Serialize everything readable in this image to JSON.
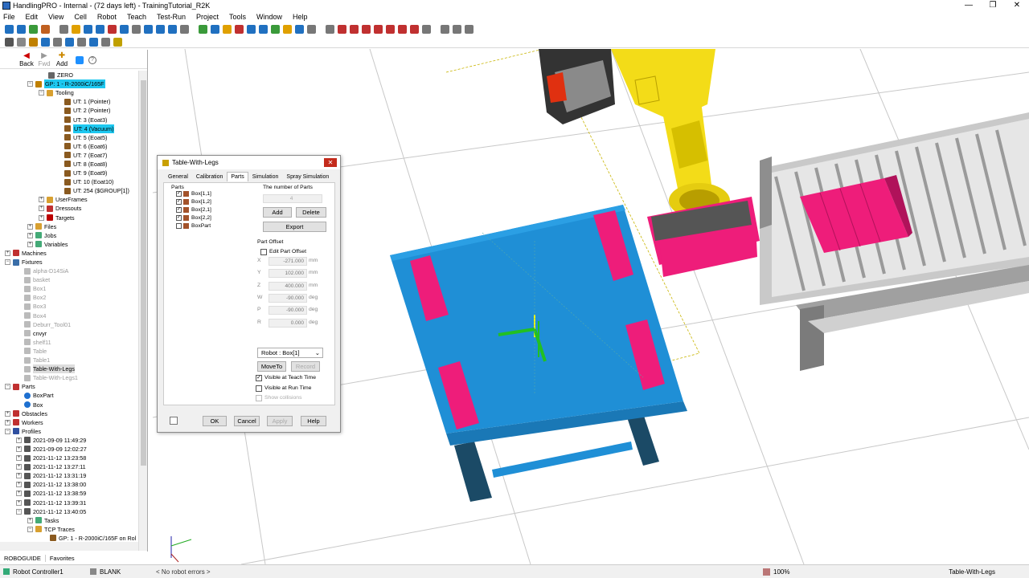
{
  "window": {
    "title": "HandlingPRO - Internal - (72 days left) - TrainingTutorial_R2K",
    "minimize": "—",
    "restore": "❐",
    "close": "✕"
  },
  "menu": [
    "File",
    "Edit",
    "View",
    "Cell",
    "Robot",
    "Teach",
    "Test-Run",
    "Project",
    "Tools",
    "Window",
    "Help"
  ],
  "nav": {
    "back": "Back",
    "fwd": "Fwd",
    "add": "Add"
  },
  "tree": [
    {
      "indent": 60,
      "label": "ZERO",
      "icon": "frame",
      "ex": ""
    },
    {
      "indent": 34,
      "label": "GP: 1 - R-2000iC/165F",
      "icon": "robot",
      "ex": "−",
      "sel": true
    },
    {
      "indent": 48,
      "label": "Tooling",
      "icon": "folder",
      "ex": "−"
    },
    {
      "indent": 80,
      "label": "UT: 1  (Pointer)",
      "icon": "tool"
    },
    {
      "indent": 80,
      "label": "UT: 2  (Pointer)",
      "icon": "tool"
    },
    {
      "indent": 80,
      "label": "UT: 3  (Eoat3)",
      "icon": "tool"
    },
    {
      "indent": 80,
      "label": "UT: 4  (Vacuum)",
      "icon": "tool",
      "sel": true
    },
    {
      "indent": 80,
      "label": "UT: 5  (Eoat5)",
      "icon": "tool"
    },
    {
      "indent": 80,
      "label": "UT: 6  (Eoat6)",
      "icon": "tool"
    },
    {
      "indent": 80,
      "label": "UT: 7  (Eoat7)",
      "icon": "tool"
    },
    {
      "indent": 80,
      "label": "UT: 8  (Eoat8)",
      "icon": "tool"
    },
    {
      "indent": 80,
      "label": "UT: 9  (Eoat9)",
      "icon": "tool"
    },
    {
      "indent": 80,
      "label": "UT: 10  (Eoat10)",
      "icon": "tool"
    },
    {
      "indent": 80,
      "label": "UT: 254  ($GROUP[1])",
      "icon": "tool"
    },
    {
      "indent": 48,
      "label": "UserFrames",
      "icon": "folder",
      "ex": "+"
    },
    {
      "indent": 48,
      "label": "Dressouts",
      "icon": "dress",
      "ex": "+"
    },
    {
      "indent": 48,
      "label": "Targets",
      "icon": "target",
      "ex": "+"
    },
    {
      "indent": 34,
      "label": "Files",
      "icon": "folder",
      "ex": "+"
    },
    {
      "indent": 34,
      "label": "Jobs",
      "icon": "grid",
      "ex": "+"
    },
    {
      "indent": 34,
      "label": "Variables",
      "icon": "grid",
      "ex": "+"
    },
    {
      "indent": 6,
      "label": "Machines",
      "icon": "machine",
      "ex": "+"
    },
    {
      "indent": 6,
      "label": "Fixtures",
      "icon": "fixture",
      "ex": "−"
    },
    {
      "indent": 30,
      "label": "alpha-D14SiA",
      "icon": "fix",
      "gray": true
    },
    {
      "indent": 30,
      "label": "basket",
      "icon": "fix",
      "gray": true
    },
    {
      "indent": 30,
      "label": "Box1",
      "icon": "fix",
      "gray": true
    },
    {
      "indent": 30,
      "label": "Box2",
      "icon": "fix",
      "gray": true
    },
    {
      "indent": 30,
      "label": "Box3",
      "icon": "fix",
      "gray": true
    },
    {
      "indent": 30,
      "label": "Box4",
      "icon": "fix",
      "gray": true
    },
    {
      "indent": 30,
      "label": "Deburr_Tool01",
      "icon": "fix",
      "gray": true
    },
    {
      "indent": 30,
      "label": "cnvyr",
      "icon": "fix",
      "gray": false
    },
    {
      "indent": 30,
      "label": "shelf11",
      "icon": "fix",
      "gray": true
    },
    {
      "indent": 30,
      "label": "Table",
      "icon": "fix",
      "gray": true
    },
    {
      "indent": 30,
      "label": "Table1",
      "icon": "fix",
      "gray": true
    },
    {
      "indent": 30,
      "label": "Table-With-Legs",
      "icon": "fix",
      "gray": false,
      "hl": true
    },
    {
      "indent": 30,
      "label": "Table-With-Legs1",
      "icon": "fix",
      "gray": true
    },
    {
      "indent": 6,
      "label": "Parts",
      "icon": "parts",
      "ex": "−"
    },
    {
      "indent": 30,
      "label": "BoxPart",
      "icon": "part"
    },
    {
      "indent": 30,
      "label": "Box",
      "icon": "part"
    },
    {
      "indent": 6,
      "label": "Obstacles",
      "icon": "obst",
      "ex": "+"
    },
    {
      "indent": 6,
      "label": "Workers",
      "icon": "worker",
      "ex": "+"
    },
    {
      "indent": 6,
      "label": "Profiles",
      "icon": "profile",
      "ex": "−"
    },
    {
      "indent": 20,
      "label": "2021-09-09 11:49:29",
      "icon": "prof",
      "ex": "+"
    },
    {
      "indent": 20,
      "label": "2021-09-09 12:02:27",
      "icon": "prof",
      "ex": "+"
    },
    {
      "indent": 20,
      "label": "2021-11-12 13:23:58",
      "icon": "prof",
      "ex": "+"
    },
    {
      "indent": 20,
      "label": "2021-11-12 13:27:11",
      "icon": "prof",
      "ex": "+"
    },
    {
      "indent": 20,
      "label": "2021-11-12 13:31:19",
      "icon": "prof",
      "ex": "+"
    },
    {
      "indent": 20,
      "label": "2021-11-12 13:38:00",
      "icon": "prof",
      "ex": "+"
    },
    {
      "indent": 20,
      "label": "2021-11-12 13:38:59",
      "icon": "prof",
      "ex": "+"
    },
    {
      "indent": 20,
      "label": "2021-11-12 13:39:31",
      "icon": "prof",
      "ex": "+"
    },
    {
      "indent": 20,
      "label": "2021-11-12 13:40:05",
      "icon": "prof",
      "ex": "−"
    },
    {
      "indent": 34,
      "label": "Tasks",
      "icon": "grid",
      "ex": "+"
    },
    {
      "indent": 34,
      "label": "TCP Traces",
      "icon": "folder",
      "ex": "−"
    },
    {
      "indent": 62,
      "label": "GP: 1 - R-2000iC/165F on Rol",
      "icon": "tool"
    }
  ],
  "left_tabs": [
    "ROBOGUIDE",
    "Favorites"
  ],
  "status": {
    "controller": "Robot Controller1",
    "blank": "BLANK",
    "errors": "< No robot errors >",
    "zoom": "100%",
    "selection": "Table-With-Legs"
  },
  "dialog": {
    "title": "Table-With-Legs",
    "close": "✕",
    "tabs": [
      "General",
      "Calibration",
      "Parts",
      "Simulation",
      "Spray Simulation"
    ],
    "active_tab": "Parts",
    "parts_label": "Parts",
    "parts": [
      {
        "label": "Box[1,1]",
        "checked": true
      },
      {
        "label": "Box[1,2]",
        "checked": true
      },
      {
        "label": "Box[2,1]",
        "checked": true
      },
      {
        "label": "Box[2,2]",
        "checked": true
      },
      {
        "label": "BoxPart",
        "checked": false
      }
    ],
    "num_parts_label": "The number of Parts",
    "num_parts": "4",
    "add": "Add",
    "delete": "Delete",
    "export": "Export",
    "offset_label": "Part Offset",
    "edit_offset": "Edit Part Offset",
    "fields": [
      {
        "label": "X",
        "value": "-271.000",
        "unit": "mm"
      },
      {
        "label": "Y",
        "value": "102.000",
        "unit": "mm"
      },
      {
        "label": "Z",
        "value": "400.000",
        "unit": "mm"
      },
      {
        "label": "W",
        "value": "-90.000",
        "unit": "deg"
      },
      {
        "label": "P",
        "value": "-90.000",
        "unit": "deg"
      },
      {
        "label": "R",
        "value": "0.000",
        "unit": "deg"
      }
    ],
    "robot_select": "Robot : Box[1]",
    "moveto": "MoveTo",
    "record": "Record",
    "visible_teach": "Visible at Teach Time",
    "visible_run": "Visible at Run Time",
    "show_collisions": "Show collisions",
    "ok": "OK",
    "cancel": "Cancel",
    "apply": "Apply",
    "help": "Help"
  },
  "scene": {
    "table_color": "#1f8fd6",
    "box_color": "#ee1d7a",
    "robot_color": "#f3dc18"
  }
}
